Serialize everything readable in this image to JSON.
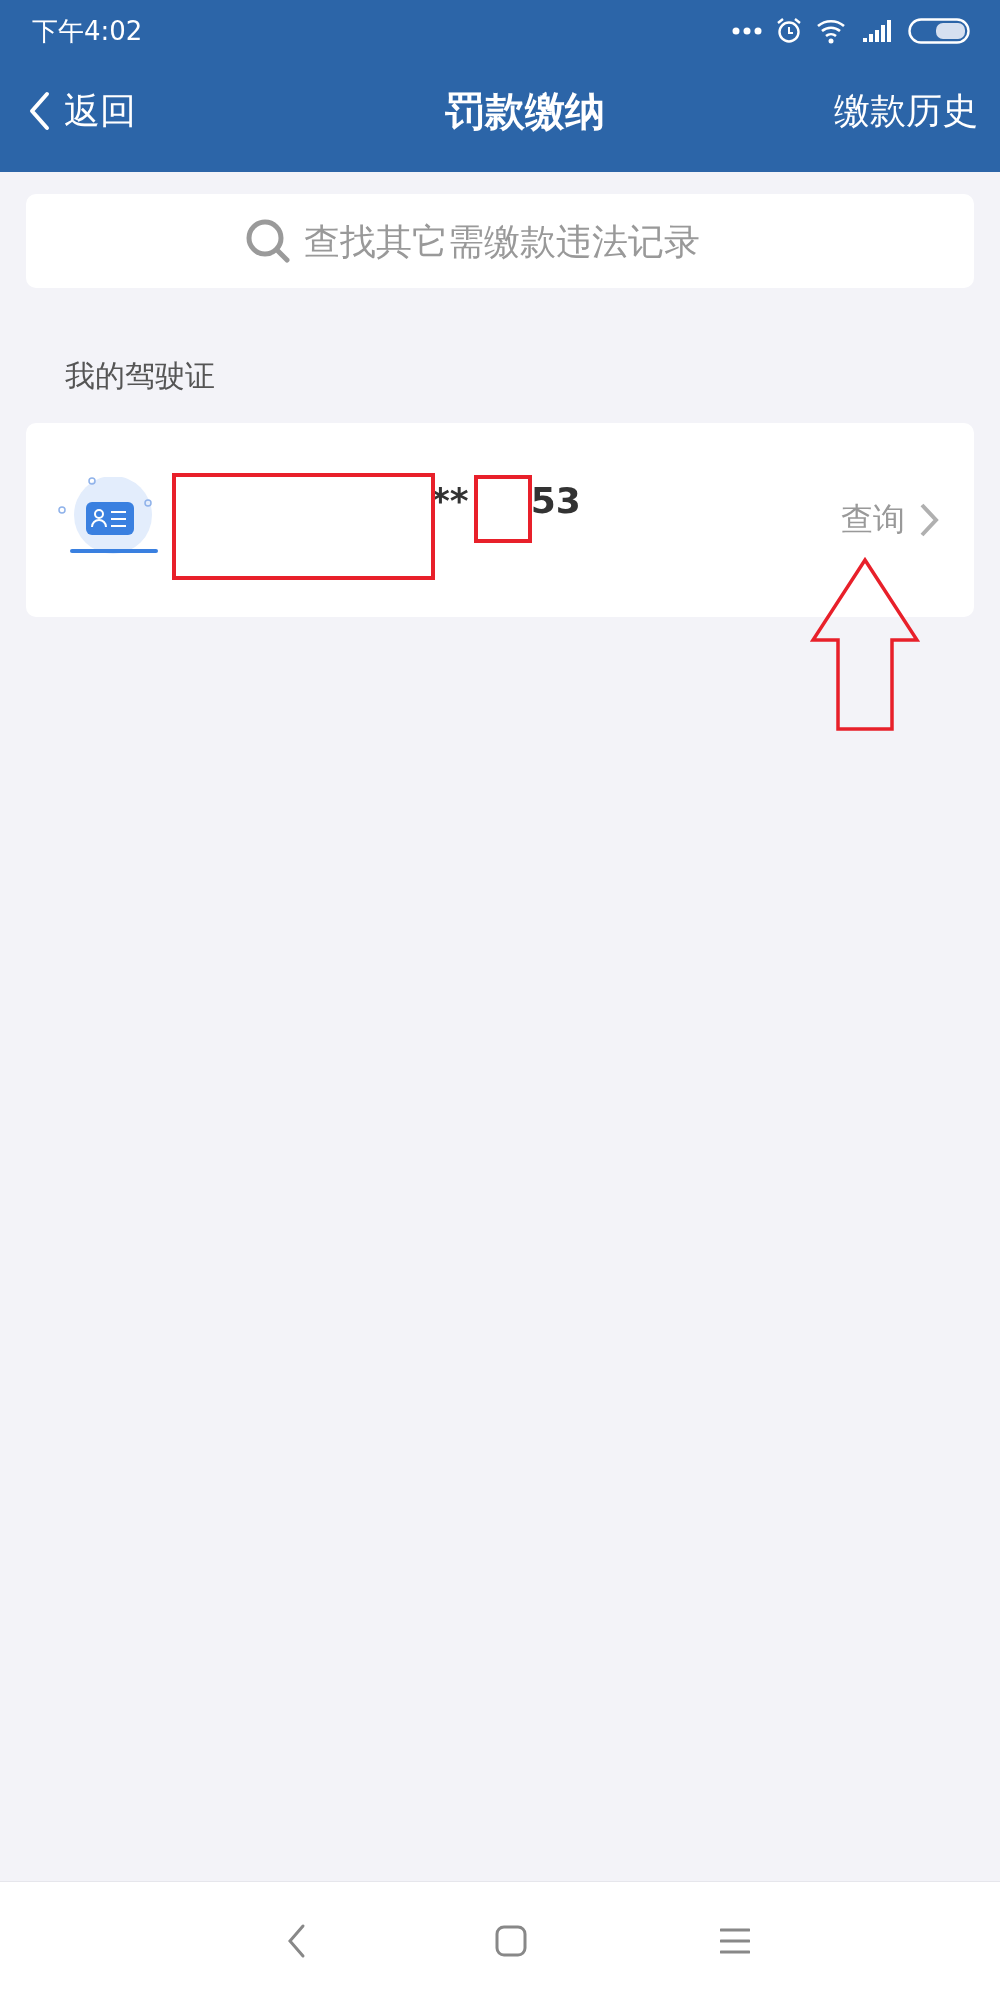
{
  "status_bar": {
    "time": "下午4:02"
  },
  "header": {
    "back_label": "返回",
    "title": "罚款缴纳",
    "action": "缴款历史"
  },
  "search": {
    "placeholder": "查找其它需缴款违法记录"
  },
  "section": {
    "title": "我的驾驶证"
  },
  "license_card": {
    "number_parts": [
      "**",
      "53"
    ],
    "action": "查询"
  }
}
